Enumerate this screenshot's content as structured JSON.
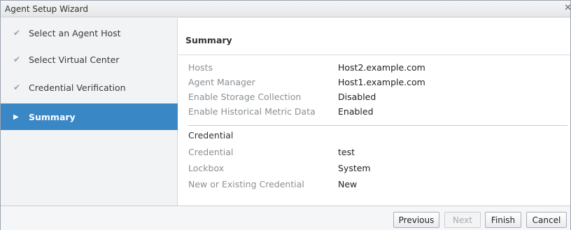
{
  "window": {
    "title": "Agent Setup Wizard"
  },
  "sidebar": {
    "steps": [
      {
        "label": "Select an Agent Host",
        "state": "done"
      },
      {
        "label": "Select Virtual Center",
        "state": "done"
      },
      {
        "label": "Credential Verification",
        "state": "done"
      },
      {
        "label": "Summary",
        "state": "active"
      }
    ]
  },
  "summary": {
    "heading": "Summary",
    "rows": [
      {
        "label": "Hosts",
        "value": "Host2.example.com"
      },
      {
        "label": "Agent Manager",
        "value": "Host1.example.com"
      },
      {
        "label": "Enable Storage Collection",
        "value": "Disabled"
      },
      {
        "label": "Enable Historical Metric Data",
        "value": "Enabled"
      }
    ],
    "credential_section": {
      "title": "Credential",
      "rows": [
        {
          "label": "Credential",
          "value": "test"
        },
        {
          "label": "Lockbox",
          "value": "System"
        },
        {
          "label": "New or Existing Credential",
          "value": "New"
        }
      ]
    }
  },
  "footer": {
    "previous_label": "Previous",
    "next_label": "Next",
    "finish_label": "Finish",
    "cancel_label": "Cancel"
  },
  "icons": {
    "done": "check-icon",
    "active": "triangle-right-icon",
    "close": "close-icon"
  },
  "colors": {
    "active_step_bg": "#3a87c6",
    "label_gray": "#8a8f94"
  }
}
